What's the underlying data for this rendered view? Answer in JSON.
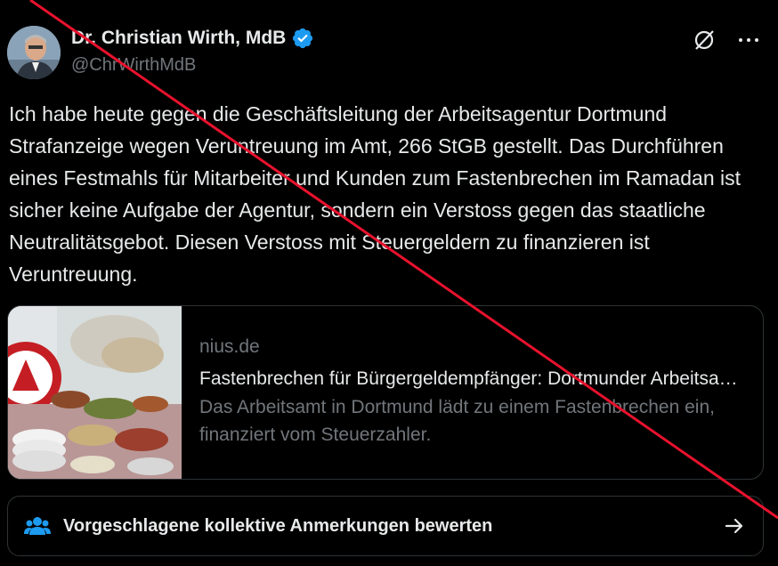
{
  "author": {
    "name": "Dr. Christian Wirth, MdB",
    "handle": "@ChrWirthMdB"
  },
  "tweet": {
    "text": "Ich habe heute gegen die Geschäftsleitung der Arbeitsagentur Dortmund Strafanzeige wegen Veruntreuung im Amt, 266 StGB gestellt. Das Durchführen eines Festmahls für Mitarbeiter und Kunden zum Fastenbrechen im Ramadan ist sicher keine Aufgabe der Agentur, sondern ein Verstoss gegen das staatliche Neutralitätsgebot. Diesen Verstoss mit Steuergeldern zu finanzieren ist Veruntreuung."
  },
  "link_card": {
    "domain": "nius.de",
    "title": "Fastenbrechen für Bürgergeldempfänger: Dortmunder Arbeitsamt lädt zum Fastenbrechen",
    "description": "Das Arbeitsamt in Dortmund lädt zu einem Fastenbrechen ein, finanziert vom Steuerzahler."
  },
  "community_notes": {
    "label": "Vorgeschlagene kollektive Anmerkungen bewerten"
  },
  "colors": {
    "verified": "#1d9bf0",
    "slash_line": "#e8122d",
    "text": "#e7e9ea",
    "muted": "#71767b",
    "border": "#2f3336"
  },
  "icons": {
    "top_right": [
      "grok-icon",
      "more-icon"
    ],
    "notes": "people-icon",
    "arrow": "arrow-right-icon"
  }
}
